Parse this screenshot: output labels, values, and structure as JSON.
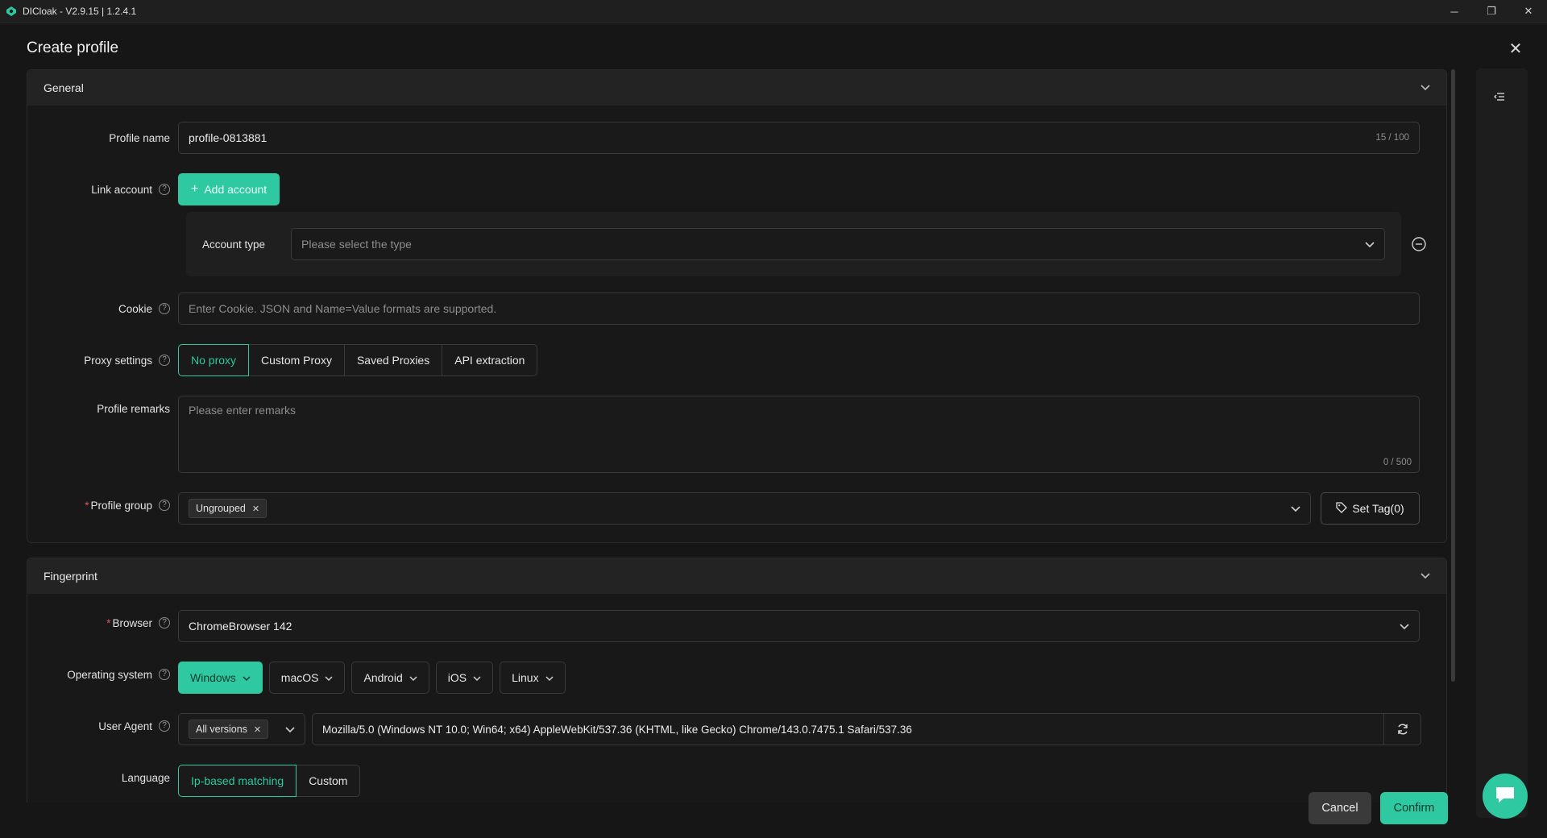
{
  "window": {
    "title": "DICloak - V2.9.15 | 1.2.4.1",
    "minimize": "─",
    "maximize": "❐",
    "close": "✕"
  },
  "dialog": {
    "title": "Create profile",
    "close": "✕"
  },
  "general": {
    "header": "General",
    "profile_name": {
      "label": "Profile name",
      "value": "profile-0813881",
      "counter": "15 / 100"
    },
    "link_account": {
      "label": "Link account",
      "add_button": "Add account",
      "account_type_label": "Account type",
      "account_type_placeholder": "Please select the type"
    },
    "cookie": {
      "label": "Cookie",
      "placeholder": "Enter Cookie. JSON and Name=Value formats are supported."
    },
    "proxy": {
      "label": "Proxy settings",
      "options": [
        "No proxy",
        "Custom Proxy",
        "Saved Proxies",
        "API extraction"
      ],
      "selected": "No proxy"
    },
    "remarks": {
      "label": "Profile remarks",
      "placeholder": "Please enter remarks",
      "counter": "0 / 500"
    },
    "group": {
      "label": "Profile group",
      "tag": "Ungrouped",
      "set_tag": "Set Tag(0)"
    }
  },
  "fingerprint": {
    "header": "Fingerprint",
    "browser": {
      "label": "Browser",
      "value": "ChromeBrowser 142"
    },
    "os": {
      "label": "Operating system",
      "options": [
        "Windows",
        "macOS",
        "Android",
        "iOS",
        "Linux"
      ],
      "selected": "Windows"
    },
    "user_agent": {
      "label": "User Agent",
      "version_tag": "All versions",
      "value": "Mozilla/5.0 (Windows NT 10.0; Win64; x64) AppleWebKit/537.36 (KHTML, like Gecko) Chrome/143.0.7475.1 Safari/537.36"
    },
    "language": {
      "label": "Language",
      "options": [
        "Ip-based matching",
        "Custom"
      ],
      "selected": "Ip-based matching"
    }
  },
  "footer": {
    "cancel": "Cancel",
    "confirm": "Confirm"
  },
  "colors": {
    "accent": "#2ec9a0",
    "background": "#161616"
  }
}
